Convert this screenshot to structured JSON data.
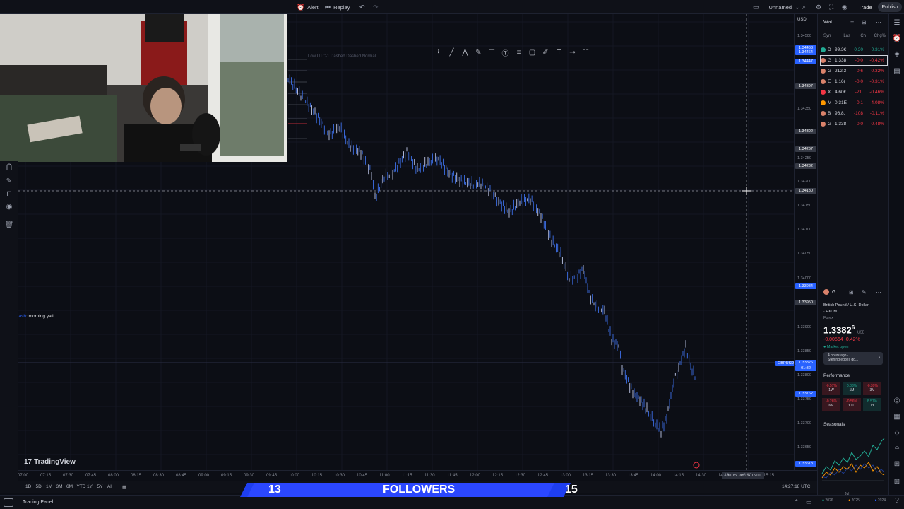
{
  "topbar": {
    "alert": "Alert",
    "replay": "Replay",
    "layout_name": "Unnamed",
    "trade": "Trade",
    "publish": "Publish"
  },
  "chart": {
    "symbol_tag": "GBPUSD",
    "legend_text": "Low UTC-1 Dashed Dashed Normal",
    "currency": "USD",
    "watermark": "TradingView",
    "price_ticks": [
      "1.34500",
      "1.34350",
      "1.34250",
      "1.34200",
      "1.34150",
      "1.34100",
      "1.34050",
      "1.34000",
      "1.33900",
      "1.33850",
      "1.33800",
      "1.33750",
      "1.33700",
      "1.33650"
    ],
    "price_tags": [
      {
        "label": "1.34468",
        "color": "#2962ff"
      },
      {
        "label": "1.34464",
        "color": "#2962ff"
      },
      {
        "label": "1.34447",
        "color": "#2962ff"
      },
      {
        "label": "1.34397",
        "color": "#363a45"
      },
      {
        "label": "1.34302",
        "color": "#363a45"
      },
      {
        "label": "1.34267",
        "color": "#363a45"
      },
      {
        "label": "1.34232",
        "color": "#363a45"
      },
      {
        "label": "1.34180",
        "color": "#363a45"
      },
      {
        "label": "1.33984",
        "color": "#2962ff"
      },
      {
        "label": "1.33950",
        "color": "#363a45"
      },
      {
        "label": "1.33826",
        "color": "#2962ff"
      },
      {
        "label": "01:32",
        "color": "#2962ff"
      },
      {
        "label": "1.33762",
        "color": "#2962ff"
      },
      {
        "label": "1.33618",
        "color": "#2962ff"
      }
    ],
    "time_ticks": [
      "07:00",
      "07:15",
      "07:30",
      "07:45",
      "08:00",
      "08:15",
      "08:30",
      "08:45",
      "09:00",
      "09:15",
      "09:30",
      "09:45",
      "10:00",
      "10:15",
      "10:30",
      "10:45",
      "11:00",
      "11:15",
      "11:30",
      "11:45",
      "12:00",
      "12:15",
      "12:30",
      "12:45",
      "13:00",
      "13:15",
      "13:30",
      "13:45",
      "14:00",
      "14:15",
      "14:30",
      "14:45",
      "15:00",
      "15:15"
    ],
    "time_cursor": "Thu 15 Jan '26  15:00",
    "chat_user": "YezCash",
    "chat_message": ": morning yall",
    "colors": {
      "candle": "#3d6fe8",
      "candle_up": "#c0c8e8",
      "crosshair": "#9598a1"
    }
  },
  "bottombar": {
    "ranges": [
      "1D",
      "5D",
      "1M",
      "3M",
      "6M",
      "YTD",
      "1Y",
      "5Y",
      "All"
    ],
    "clock": "14:27:18 UTC",
    "panel": "Trading Panel"
  },
  "followers": {
    "left": "13",
    "label": "FOLLOWERS",
    "right": "15"
  },
  "watchlist": {
    "title": "Wat...",
    "cols": [
      "Syn",
      "Las",
      "Ch",
      "Chg%"
    ],
    "rows": [
      {
        "sym": "D",
        "last": "99.3€",
        "ch": "0.30",
        "pct": "0.31%",
        "dot": "#22ab94",
        "dir": "pos"
      },
      {
        "sym": "G",
        "last": "1.338",
        "ch": "-0.0",
        "pct": "-0.42%",
        "dot": "#d9826b",
        "dir": "neg"
      },
      {
        "sym": "G",
        "last": "212.3",
        "ch": "-0.6",
        "pct": "-0.32%",
        "dot": "#d9826b",
        "dir": "neg"
      },
      {
        "sym": "E",
        "last": "1.16(",
        "ch": "-0.0",
        "pct": "-0.31%",
        "dot": "#d9826b",
        "dir": "neg"
      },
      {
        "sym": "X",
        "last": "4,60£",
        "ch": "-21.",
        "pct": "-0.46%",
        "dot": "#f23645",
        "dir": "neg"
      },
      {
        "sym": "M",
        "last": "0.31E",
        "ch": "-0.1",
        "pct": "-4.08%",
        "dot": "#ff9800",
        "dir": "neg"
      },
      {
        "sym": "B",
        "last": "96,8.",
        "ch": "-108",
        "pct": "-0.11%",
        "dot": "#d9826b",
        "dir": "neg"
      },
      {
        "sym": "G",
        "last": "1.338",
        "ch": "-0.0",
        "pct": "-0.48%",
        "dot": "#d9826b",
        "dir": "neg"
      }
    ]
  },
  "details": {
    "sym": "G",
    "name": "British Pound / U.S. Dollar",
    "exchange": "· FXCM",
    "type": "Forex",
    "price": "1.3382",
    "price_sup": "6",
    "price_unit": "USD",
    "change": "-0.00564",
    "change_pct": "-0.42%",
    "status": "Market open",
    "news_time": "4 hours ago ·",
    "news_title": "Sterling edges do...",
    "performance_title": "Performance",
    "performance": [
      {
        "value": "-0.57%",
        "period": "1W"
      },
      {
        "value": "0.08%",
        "period": "1M"
      },
      {
        "value": "-0.39%",
        "period": "3M"
      },
      {
        "value": "-0.26%",
        "period": "6M"
      },
      {
        "value": "-0.56%",
        "period": "YTD"
      },
      {
        "value": "8.57%",
        "period": "1Y"
      }
    ],
    "seasonals_title": "Seasonals",
    "seasonals_month": "Jul",
    "seasonals_years": [
      "2026",
      "2025",
      "2024"
    ]
  }
}
